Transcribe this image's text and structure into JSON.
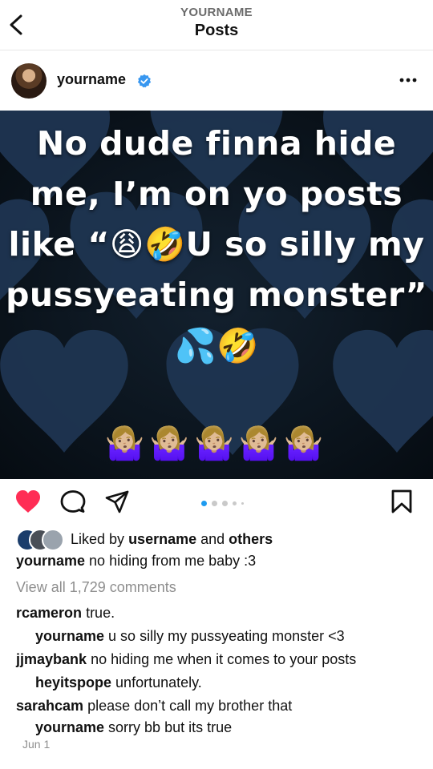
{
  "header": {
    "account": "YOURNAME",
    "title": "Posts"
  },
  "post": {
    "username": "yourname",
    "verified": true,
    "image": {
      "lines": [
        "No dude finna hide",
        "me, I’m on yo posts",
        "like “😩🤣U so silly my",
        "pussyeating monster”"
      ],
      "emoji_line": "💦🤣",
      "hands_line": "🤷🏼‍♀️🤷🏼‍♀️🤷🏼‍♀️🤷🏼‍♀️🤷🏼‍♀️"
    },
    "carousel": {
      "count": 5,
      "active_index": 0
    },
    "likes": {
      "prefix": "Liked by",
      "user": "username",
      "middle": "and",
      "others": "others"
    },
    "caption": {
      "user": "yourname",
      "text": "no hiding from me baby :3"
    },
    "view_all": "View all 1,729 comments",
    "comments": [
      {
        "user": "rcameron",
        "text": "true.",
        "reply": false
      },
      {
        "user": "yourname",
        "text": "u so silly my pussyeating monster <3",
        "reply": true
      },
      {
        "user": "jjmaybank",
        "text": "no hiding me when it comes to your posts",
        "reply": false
      },
      {
        "user": "heyitspope",
        "text": "unfortunately.",
        "reply": true
      },
      {
        "user": "sarahcam",
        "text": "please don’t call my brother that",
        "reply": false
      },
      {
        "user": "yourname",
        "text": "sorry bb but its true",
        "reply": true
      }
    ],
    "date": "Jun 1"
  },
  "colors": {
    "like_red": "#ff2d55",
    "verified_blue": "#3897f0",
    "muted": "#8e8e8e",
    "image_bg": "#0c1620",
    "heart_shape": "#1f3552"
  },
  "icons": {
    "back": "chevron-left-icon",
    "more": "ellipsis-icon",
    "like": "heart-icon",
    "comment": "speech-bubble-icon",
    "share": "paper-plane-icon",
    "save": "bookmark-icon"
  }
}
